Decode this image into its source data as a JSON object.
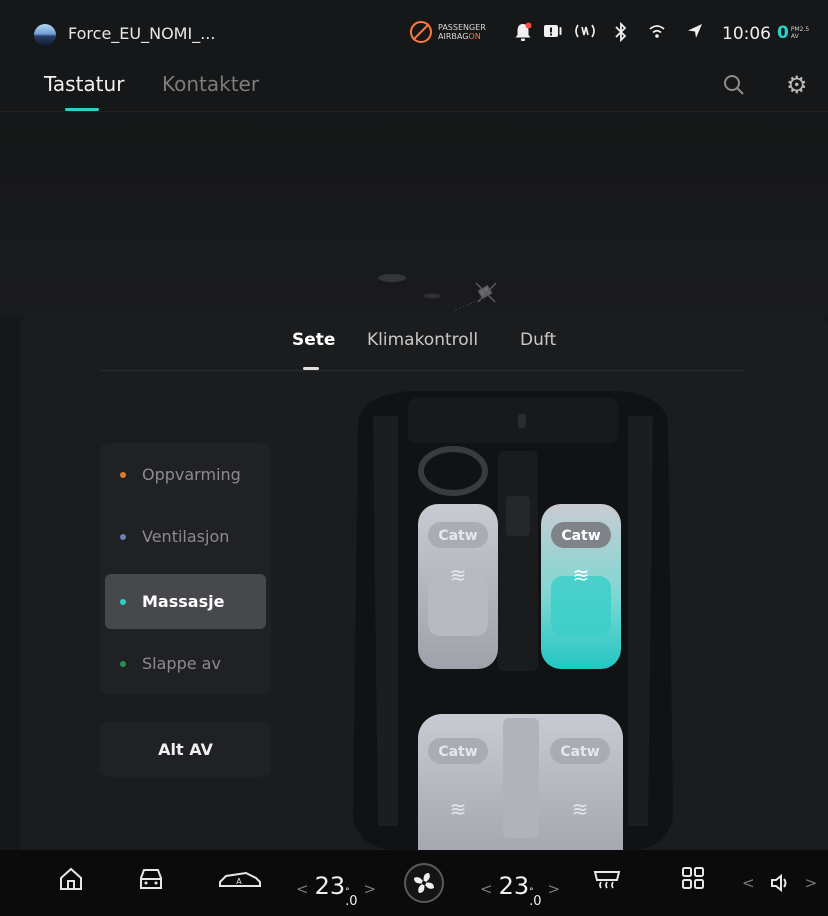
{
  "status_bar": {
    "profile_name": "Force_EU_NOMI_...",
    "airbag_line1": "PASSENGER",
    "airbag_line2": "AIRBAG",
    "airbag_state": "ON",
    "time": "10:06",
    "pm_value": "0",
    "pm_label_top": "PM2.5",
    "pm_label_bottom": "AV",
    "icons": [
      "bell-alert-icon",
      "media-icon",
      "nfc-icon",
      "bluetooth-icon",
      "wifi-icon",
      "location-arrow-icon"
    ]
  },
  "top_tabs": [
    {
      "label": "Tastatur",
      "active": true
    },
    {
      "label": "Kontakter",
      "active": false
    }
  ],
  "seat_panel": {
    "tabs": [
      {
        "label": "Sete",
        "active": true
      },
      {
        "label": "Klimakontroll",
        "active": false
      },
      {
        "label": "Duft",
        "active": false
      }
    ],
    "modes": [
      {
        "label": "Oppvarming",
        "dot_color": "#e07a2e",
        "active": false
      },
      {
        "label": "Ventilasjon",
        "dot_color": "#6f7fb8",
        "active": false
      },
      {
        "label": "Massasje",
        "dot_color": "#2ad0c9",
        "active": true
      },
      {
        "label": "Slappe av",
        "dot_color": "#2e8b57",
        "active": false
      }
    ],
    "all_off_label": "Alt AV",
    "seats": [
      {
        "position": "front-left",
        "label": "Catw",
        "active": false
      },
      {
        "position": "front-right",
        "label": "Catw",
        "active": true
      },
      {
        "position": "rear-left",
        "label": "Catw",
        "active": false
      },
      {
        "position": "rear-right",
        "label": "Catw",
        "active": false
      }
    ]
  },
  "dock": {
    "left_temp_whole": "23",
    "left_temp_decimal": ".0",
    "right_temp_whole": "23",
    "right_temp_decimal": ".0",
    "temp_unit": "°",
    "left_arrow": "<",
    "right_arrow": ">"
  },
  "colors": {
    "accent": "#2ad0c9",
    "airbag_warning": "#ff7a3d"
  }
}
